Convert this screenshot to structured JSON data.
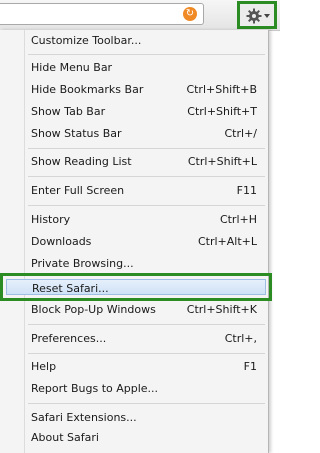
{
  "toolbar": {
    "reload_glyph": "↻",
    "gear_icon": "gear-icon"
  },
  "menu": {
    "items": [
      {
        "label": "Customize Toolbar...",
        "shortcut": ""
      },
      {
        "label": "Hide Menu Bar",
        "shortcut": ""
      },
      {
        "label": "Hide Bookmarks Bar",
        "shortcut": "Ctrl+Shift+B"
      },
      {
        "label": "Show Tab Bar",
        "shortcut": "Ctrl+Shift+T"
      },
      {
        "label": "Show Status Bar",
        "shortcut": "Ctrl+/"
      },
      {
        "label": "Show Reading List",
        "shortcut": "Ctrl+Shift+L"
      },
      {
        "label": "Enter Full Screen",
        "shortcut": "F11"
      },
      {
        "label": "History",
        "shortcut": "Ctrl+H"
      },
      {
        "label": "Downloads",
        "shortcut": "Ctrl+Alt+L"
      },
      {
        "label": "Private Browsing...",
        "shortcut": ""
      },
      {
        "label": "Reset Safari...",
        "shortcut": ""
      },
      {
        "label": "Block Pop-Up Windows",
        "shortcut": "Ctrl+Shift+K"
      },
      {
        "label": "Preferences...",
        "shortcut": "Ctrl+,"
      },
      {
        "label": "Help",
        "shortcut": "F1"
      },
      {
        "label": "Report Bugs to Apple...",
        "shortcut": ""
      },
      {
        "label": "Safari Extensions...",
        "shortcut": ""
      },
      {
        "label": "About Safari",
        "shortcut": ""
      }
    ]
  },
  "colors": {
    "highlight_border": "#2a8c22",
    "reload_orange": "#f08a24",
    "selected_fill": "#cfe2f7"
  }
}
